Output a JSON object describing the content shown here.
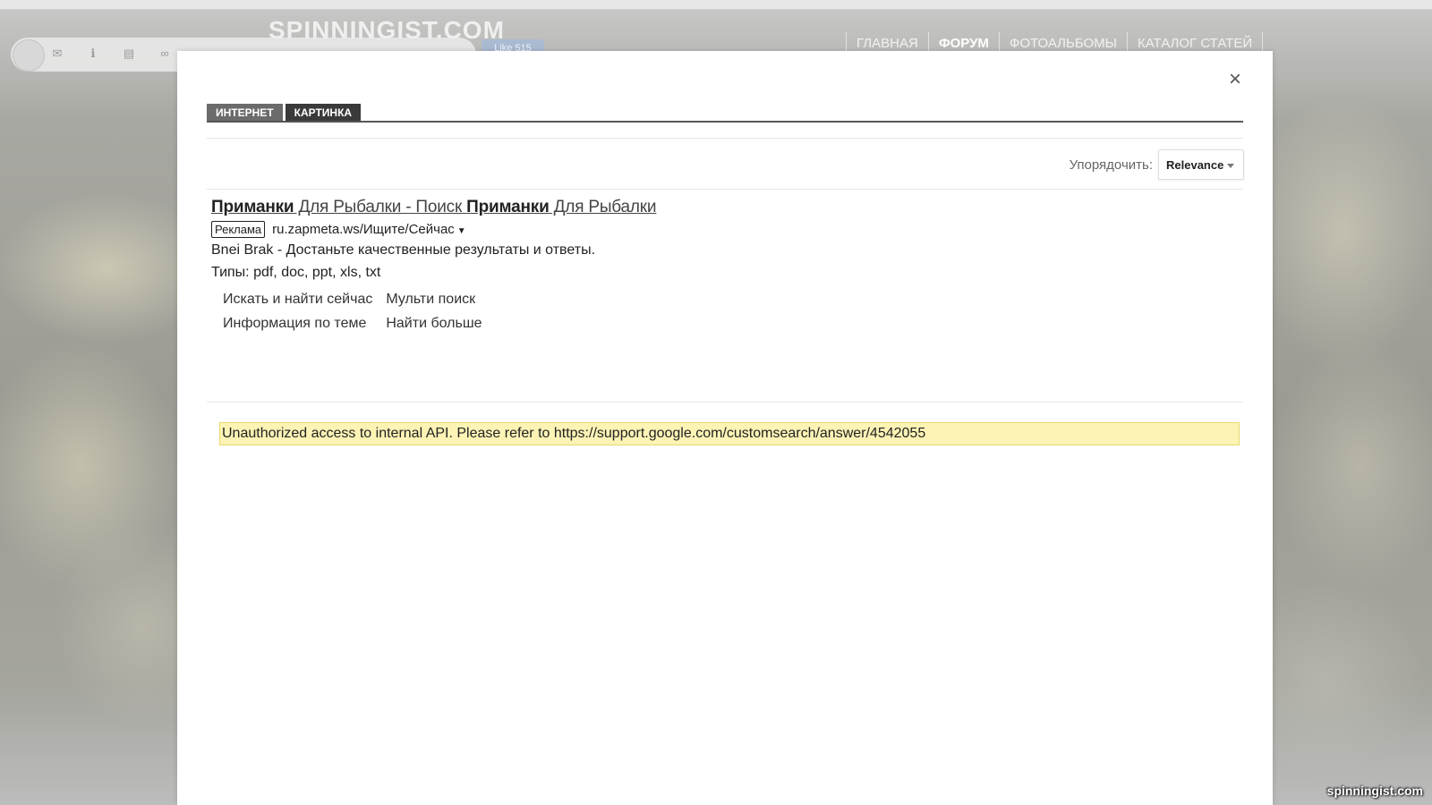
{
  "site": {
    "logo": "SPINNINGIST.COM",
    "like_label": "Like 515",
    "nav": [
      {
        "label": "ГЛАВНАЯ",
        "active": false
      },
      {
        "label": "ФОРУМ",
        "active": true
      },
      {
        "label": "ФОТОАЛЬБОМЫ",
        "active": false
      },
      {
        "label": "КАТАЛОГ СТАТЕЙ",
        "active": false
      }
    ],
    "watermark": "spinningist.com",
    "toolbar_icons": [
      "mail-icon",
      "info-icon",
      "document-icon",
      "link-icon"
    ]
  },
  "modal": {
    "close_label": "×",
    "tabs": {
      "web": "ИНТЕРНЕТ",
      "image": "КАРТИНКА"
    },
    "sort": {
      "label": "Упорядочить:",
      "value": "Relevance"
    },
    "ad": {
      "title_part1_bold": "Приманки",
      "title_part2": " Для Рыбалки - Поиск ",
      "title_part3_bold": "Приманки",
      "title_part4": " Для Рыбалки",
      "badge": "Реклама",
      "url": "ru.zapmeta.ws/Ищите/Сейчас",
      "url_arrow": "▼",
      "description": "Bnei Brak - Достаньте качественные результаты и ответы.",
      "types": "Типы: pdf, doc, ppt, xls, txt",
      "sitelinks": [
        "Искать и найти сейчас",
        "Мульти поиск",
        "Информация по теме",
        "Найти больше"
      ]
    },
    "error_message": "Unauthorized access to internal API. Please refer to https://support.google.com/customsearch/answer/4542055"
  }
}
